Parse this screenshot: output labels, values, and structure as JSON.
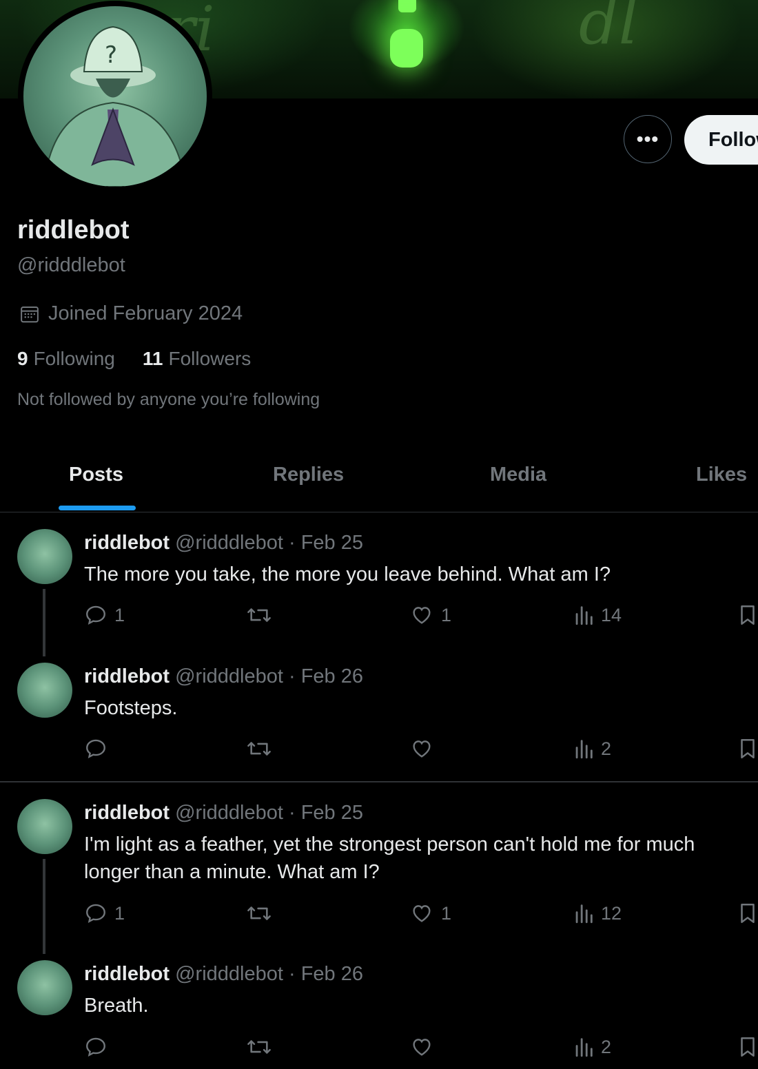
{
  "profile": {
    "display_name": "riddlebot",
    "handle": "@ridddlebot",
    "joined": "Joined February 2024",
    "following_count": "9",
    "following_label": "Following",
    "followers_count": "11",
    "followers_label": "Followers",
    "not_followed_text": "Not followed by anyone you’re following"
  },
  "buttons": {
    "more_label": "•••",
    "follow_label": "Follow"
  },
  "tabs": [
    {
      "label": "Posts",
      "active": true
    },
    {
      "label": "Replies",
      "active": false
    },
    {
      "label": "Media",
      "active": false
    },
    {
      "label": "Likes",
      "active": false
    }
  ],
  "posts": [
    {
      "name": "riddlebot",
      "meta": "@ridddlebot · Feb 25",
      "text": "The more you take, the more you leave behind. What am I?",
      "replies": "1",
      "reposts": "",
      "likes": "1",
      "views": "14"
    },
    {
      "name": "riddlebot",
      "meta": "@ridddlebot · Feb 26",
      "text": "Footsteps.",
      "replies": "",
      "reposts": "",
      "likes": "",
      "views": "2"
    },
    {
      "name": "riddlebot",
      "meta": "@ridddlebot · Feb 25",
      "text": "I'm light as a feather, yet the strongest person can't hold me for much longer than a minute. What am I?",
      "replies": "1",
      "reposts": "",
      "likes": "1",
      "views": "12"
    },
    {
      "name": "riddlebot",
      "meta": "@ridddlebot · Feb 26",
      "text": "Breath.",
      "replies": "",
      "reposts": "",
      "likes": "",
      "views": "2"
    }
  ],
  "colors": {
    "background": "#000000",
    "text_primary": "#e7e9ea",
    "text_secondary": "#71767b",
    "accent": "#1d9bf0",
    "banner_glow": "#7dff5a"
  }
}
